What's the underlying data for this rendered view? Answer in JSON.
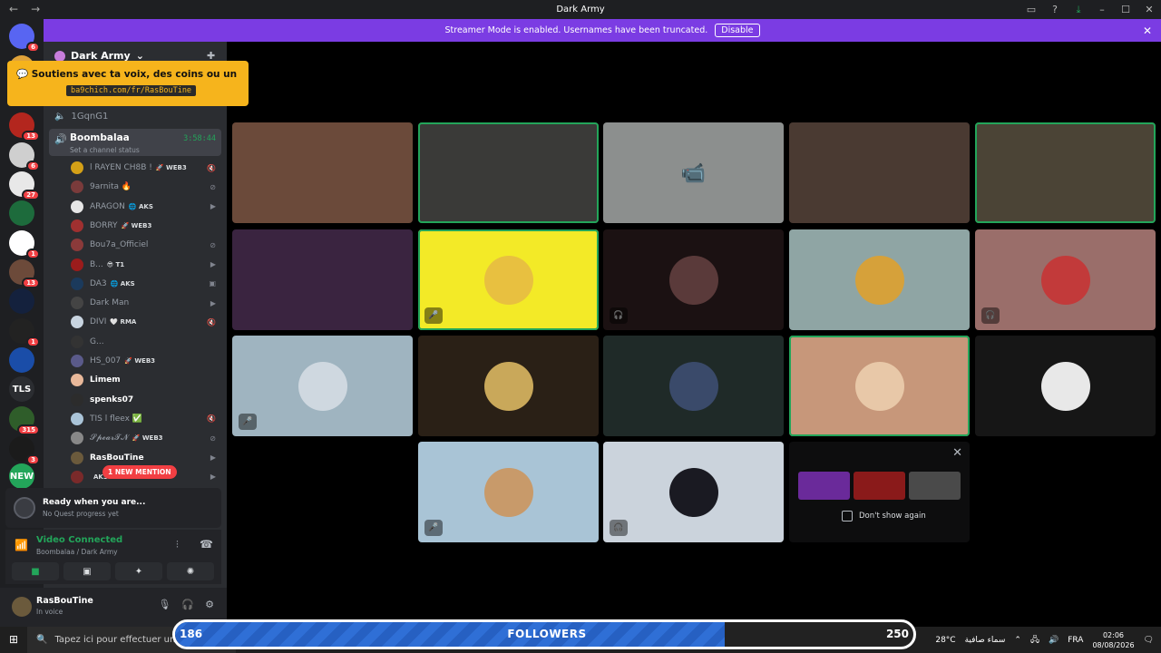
{
  "window": {
    "title": "Dark Army"
  },
  "banner": {
    "text": "Streamer Mode is enabled. Usernames have been truncated.",
    "button": "Disable"
  },
  "servers": [
    {
      "label": "",
      "color": "#5865f2",
      "badge": "6"
    },
    {
      "label": "",
      "color": "#e0a33a",
      "badge": ""
    },
    {
      "label": "",
      "color": "#b3261e",
      "badge": "13"
    },
    {
      "label": "",
      "color": "#cfcfcf",
      "badge": "6"
    },
    {
      "label": "",
      "color": "#e8e8e8",
      "badge": "27"
    },
    {
      "label": "",
      "color": "#1d6b3c",
      "badge": ""
    },
    {
      "label": "",
      "color": "#ffffff",
      "badge": "1"
    },
    {
      "label": "",
      "color": "#6c4a3a",
      "badge": "13"
    },
    {
      "label": "",
      "color": "#14213d",
      "badge": ""
    },
    {
      "label": "",
      "color": "#222222",
      "badge": "1"
    },
    {
      "label": "",
      "color": "#1a4da8",
      "badge": ""
    },
    {
      "label": "TLS",
      "color": "#2b2d31",
      "badge": ""
    },
    {
      "label": "",
      "color": "#2f5d2a",
      "badge": "315"
    },
    {
      "label": "",
      "color": "#1b1b1b",
      "badge": "3"
    },
    {
      "label": "NEW",
      "color": "#23a55a",
      "badge": ""
    }
  ],
  "server_name": "Dark Army",
  "alert": {
    "line1": "Soutiens avec ta voix, des coins ou un messa",
    "line2": "ba9chich.com/fr/RasBouTine"
  },
  "channels": {
    "prev": "1GqnG1",
    "current": {
      "name": "Boombalaa",
      "status": "Set a channel status",
      "timer": "3:58:44"
    }
  },
  "members": [
    {
      "name": "l RAYEN CH8B !",
      "tag": "🚀 WEB3",
      "color": "#d4a017",
      "icon": "muted"
    },
    {
      "name": "9arnita 🔥",
      "tag": "",
      "color": "#7a3b3b",
      "icon": "deaf"
    },
    {
      "name": "ARAGON",
      "tag": "🌐 AKS",
      "color": "#e6e6e6",
      "icon": "cam"
    },
    {
      "name": "BORRY",
      "tag": "🚀 WEB3",
      "color": "#a03030",
      "icon": ""
    },
    {
      "name": "Bou7a_Officiel",
      "tag": "",
      "color": "#8b3a3a",
      "icon": "deaf"
    },
    {
      "name": "B...",
      "tag": "😎 T1",
      "color": "#9b1c1c",
      "icon": "cam"
    },
    {
      "name": "DA3",
      "tag": "🌐 AKS",
      "color": "#1b3a5c",
      "icon": "stream"
    },
    {
      "name": "Dark Man",
      "tag": "",
      "color": "#444",
      "icon": "cam"
    },
    {
      "name": "DIVI",
      "tag": "🤍 RMA",
      "color": "#c8d4e0",
      "icon": "muted"
    },
    {
      "name": "G...",
      "tag": "",
      "color": "#333",
      "icon": ""
    },
    {
      "name": "HS_007",
      "tag": "🚀 WEB3",
      "color": "#5a5a8a",
      "icon": ""
    },
    {
      "name": "Limem",
      "tag": "",
      "color": "#e8b89a",
      "icon": "",
      "bright": true
    },
    {
      "name": "spenks07",
      "tag": "",
      "color": "#2c2c2c",
      "icon": "",
      "bright": true
    },
    {
      "name": "TIS l fleex ✅",
      "tag": "",
      "color": "#aac4d8",
      "icon": "muted"
    },
    {
      "name": "𝓢𝓹𝓮𝓪𝓻𝓣𝓝",
      "tag": "🚀 WEB3",
      "color": "#888",
      "icon": "deaf"
    },
    {
      "name": "RasBouTine",
      "tag": "",
      "color": "#6b5a3c",
      "icon": "cam",
      "bright": true
    },
    {
      "name": "",
      "tag": "AKS",
      "color": "#7a2a2a",
      "icon": "cam"
    }
  ],
  "mention": "1 NEW MENTION",
  "quest": {
    "title": "Ready when you are...",
    "sub": "No Quest progress yet"
  },
  "voice": {
    "status": "Video Connected",
    "sub": "Boombalaa / Dark Army"
  },
  "user": {
    "name": "RasBouTine",
    "status": "In voice"
  },
  "tiles": [
    {
      "bg": "#6b4a3a",
      "avatar": "",
      "speaking": false,
      "mute": ""
    },
    {
      "bg": "#3a3a38",
      "avatar": "",
      "speaking": true,
      "mute": ""
    },
    {
      "bg": "#8c8f8e",
      "avatar": "camera",
      "speaking": false,
      "mute": ""
    },
    {
      "bg": "#4a3a32",
      "avatar": "",
      "speaking": false,
      "mute": ""
    },
    {
      "bg": "#4b4436",
      "avatar": "",
      "speaking": true,
      "mute": ""
    },
    {
      "bg": "#3a2440",
      "avatar": "",
      "speaking": false,
      "mute": ""
    },
    {
      "bg": "#f3ea27",
      "avatar": "#e8c040",
      "speaking": true,
      "mute": "🎤"
    },
    {
      "bg": "#1b1112",
      "avatar": "#5a3a3a",
      "speaking": false,
      "mute": "🎧"
    },
    {
      "bg": "#8fa5a4",
      "avatar": "#d6a13a",
      "speaking": false,
      "mute": ""
    },
    {
      "bg": "#9a6e6a",
      "avatar": "#c23a3a",
      "speaking": false,
      "mute": "🎧"
    },
    {
      "bg": "#9fb4c0",
      "avatar": "#cfd8e0",
      "speaking": false,
      "mute": "🎤"
    },
    {
      "bg": "#2a2016",
      "avatar": "#c9a85a",
      "speaking": false,
      "mute": ""
    },
    {
      "bg": "#1f2a28",
      "avatar": "#3a4a6a",
      "speaking": false,
      "mute": ""
    },
    {
      "bg": "#c7977a",
      "avatar": "#e8c8a8",
      "speaking": true,
      "mute": ""
    },
    {
      "bg": "#161616",
      "avatar": "#e8e8e8",
      "speaking": false,
      "mute": ""
    },
    {
      "bg": "#a9c4d6",
      "avatar": "#c89a6a",
      "speaking": false,
      "mute": "🎤"
    },
    {
      "bg": "#cbd3dc",
      "avatar": "#1a1a22",
      "speaking": false,
      "mute": "🎧"
    }
  ],
  "promo": {
    "label": "Don't show again",
    "thumbs": [
      "#6a2a9a",
      "#8a1a1a",
      "#4a4a4a"
    ]
  },
  "taskbar": {
    "search": "Tapez ici pour effectuer une re",
    "weather": "سماء صافية",
    "temp": "28°C",
    "lang": "FRA",
    "time": "02:06",
    "date": "08/08/2026"
  },
  "followers": {
    "label": "FOLLOWERS",
    "current": "186",
    "goal": "250",
    "progress": 0.744
  }
}
